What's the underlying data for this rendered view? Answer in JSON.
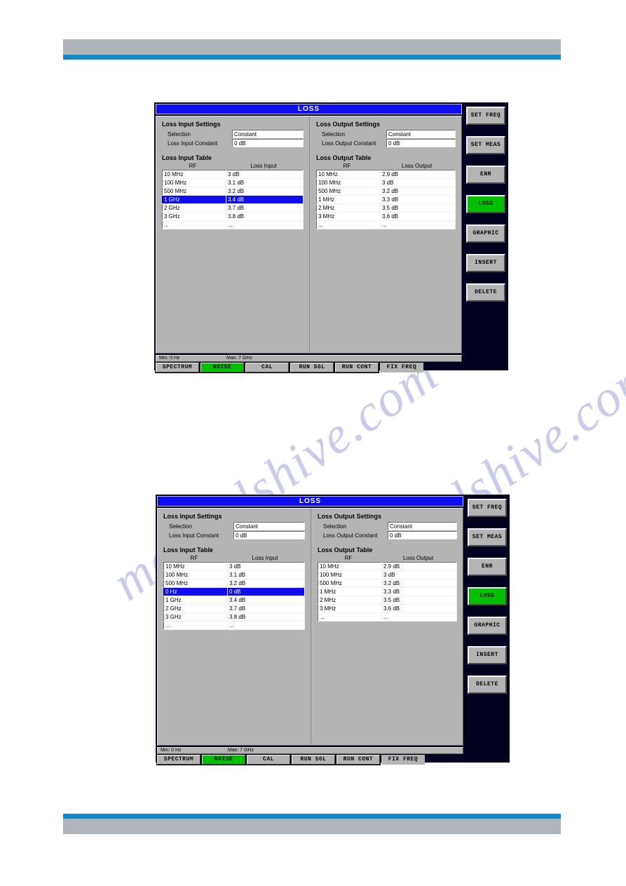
{
  "panels": [
    {
      "window_title": "LOSS",
      "input_settings": {
        "group_title": "Loss Input Settings",
        "rows": [
          {
            "label": "Selection",
            "value": "Constant"
          },
          {
            "label": "Loss Input Constant",
            "value": "0 dB"
          }
        ]
      },
      "output_settings": {
        "group_title": "Loss Output Settings",
        "rows": [
          {
            "label": "Selection",
            "value": "Constant"
          },
          {
            "label": "Loss Output Constant",
            "value": "0 dB"
          }
        ]
      },
      "input_table": {
        "title": "Loss Input Table",
        "headers": [
          "RF",
          "Loss Input"
        ],
        "rows": [
          {
            "rf": "10 MHz",
            "loss": "3 dB",
            "selected": false
          },
          {
            "rf": "100 MHz",
            "loss": "3.1 dB",
            "selected": false
          },
          {
            "rf": "500 MHz",
            "loss": "3.2 dB",
            "selected": false
          },
          {
            "rf": "1 GHz",
            "loss": "3.4 dB",
            "selected": true
          },
          {
            "rf": "2 GHz",
            "loss": "3.7 dB",
            "selected": false
          },
          {
            "rf": "3 GHz",
            "loss": "3.8 dB",
            "selected": false
          },
          {
            "rf": "...",
            "loss": "...",
            "selected": false
          }
        ]
      },
      "output_table": {
        "title": "Loss Output Table",
        "headers": [
          "RF",
          "Loss Output"
        ],
        "rows": [
          {
            "rf": "10 MHz",
            "loss": "2.9 dB",
            "selected": false
          },
          {
            "rf": "100 MHz",
            "loss": "3 dB",
            "selected": false
          },
          {
            "rf": "500 MHz",
            "loss": "3.2 dB",
            "selected": false
          },
          {
            "rf": "1 MHz",
            "loss": "3.3 dB",
            "selected": false
          },
          {
            "rf": "2 MHz",
            "loss": "3.5 dB",
            "selected": false
          },
          {
            "rf": "3 MHz",
            "loss": "3.6 dB",
            "selected": false
          },
          {
            "rf": "...",
            "loss": "...",
            "selected": false
          }
        ]
      },
      "status": {
        "min": "Min: 0 Hz",
        "max": "Max: 7 GHz"
      },
      "toolbar": [
        {
          "label": "SPECTRUM",
          "state": "normal",
          "key": "spectrum"
        },
        {
          "label": "NOISE",
          "state": "active",
          "key": "noise"
        },
        {
          "label": "CAL",
          "state": "normal",
          "key": "cal"
        },
        {
          "label": "RUN SGL",
          "state": "normal",
          "key": "run-sgl"
        },
        {
          "label": "RUN CONT",
          "state": "normal",
          "key": "run-cont"
        },
        {
          "label": "FIX FREQ",
          "state": "flat",
          "key": "fix-freq"
        }
      ],
      "softkeys": [
        {
          "label": "SET FREQ",
          "state": "normal",
          "key": "set-freq"
        },
        {
          "label": "SET MEAS",
          "state": "normal",
          "key": "set-meas"
        },
        {
          "label": "ENR",
          "state": "normal",
          "key": "enr"
        },
        {
          "label": "LOSS",
          "state": "active",
          "key": "loss"
        },
        {
          "label": "GRAPHIC",
          "state": "normal",
          "key": "graphic"
        },
        {
          "label": "INSERT",
          "state": "normal",
          "key": "insert"
        },
        {
          "label": "DELETE",
          "state": "normal",
          "key": "delete"
        }
      ]
    },
    {
      "window_title": "LOSS",
      "input_settings": {
        "group_title": "Loss Input Settings",
        "rows": [
          {
            "label": "Selection",
            "value": "Constant"
          },
          {
            "label": "Loss Input Constant",
            "value": "0 dB"
          }
        ]
      },
      "output_settings": {
        "group_title": "Loss Output Settings",
        "rows": [
          {
            "label": "Selection",
            "value": "Constant"
          },
          {
            "label": "Loss Output Constant",
            "value": "0 dB"
          }
        ]
      },
      "input_table": {
        "title": "Loss Input Table",
        "headers": [
          "RF",
          "Loss Input"
        ],
        "rows": [
          {
            "rf": "10 MHz",
            "loss": "3 dB",
            "selected": false
          },
          {
            "rf": "100 MHz",
            "loss": "3.1 dB",
            "selected": false
          },
          {
            "rf": "500 MHz",
            "loss": "3.2 dB",
            "selected": false
          },
          {
            "rf": "0 Hz",
            "loss": "0 dB",
            "selected": true
          },
          {
            "rf": "1 GHz",
            "loss": "3.4 dB",
            "selected": false
          },
          {
            "rf": "2 GHz",
            "loss": "3.7 dB",
            "selected": false
          },
          {
            "rf": "3 GHz",
            "loss": "3.8 dB",
            "selected": false
          },
          {
            "rf": "...",
            "loss": "...",
            "selected": false
          }
        ]
      },
      "output_table": {
        "title": "Loss Output Table",
        "headers": [
          "RF",
          "Loss Output"
        ],
        "rows": [
          {
            "rf": "10 MHz",
            "loss": "2.9 dB",
            "selected": false
          },
          {
            "rf": "100 MHz",
            "loss": "3 dB",
            "selected": false
          },
          {
            "rf": "500 MHz",
            "loss": "3.2 dB",
            "selected": false
          },
          {
            "rf": "1 MHz",
            "loss": "3.3 dB",
            "selected": false
          },
          {
            "rf": "2 MHz",
            "loss": "3.5 dB",
            "selected": false
          },
          {
            "rf": "3 MHz",
            "loss": "3.6 dB",
            "selected": false
          },
          {
            "rf": "...",
            "loss": "...",
            "selected": false
          }
        ]
      },
      "status": {
        "min": "Min: 0 Hz",
        "max": "Max: 7 GHz"
      },
      "toolbar": [
        {
          "label": "SPECTRUM",
          "state": "normal",
          "key": "spectrum"
        },
        {
          "label": "NOISE",
          "state": "active",
          "key": "noise"
        },
        {
          "label": "CAL",
          "state": "normal",
          "key": "cal"
        },
        {
          "label": "RUN SGL",
          "state": "normal",
          "key": "run-sgl"
        },
        {
          "label": "RUN CONT",
          "state": "normal",
          "key": "run-cont"
        },
        {
          "label": "FIX FREQ",
          "state": "flat",
          "key": "fix-freq"
        }
      ],
      "softkeys": [
        {
          "label": "SET FREQ",
          "state": "normal",
          "key": "set-freq"
        },
        {
          "label": "SET MEAS",
          "state": "normal",
          "key": "set-meas"
        },
        {
          "label": "ENR",
          "state": "normal",
          "key": "enr"
        },
        {
          "label": "LOSS",
          "state": "active",
          "key": "loss"
        },
        {
          "label": "GRAPHIC",
          "state": "normal",
          "key": "graphic"
        },
        {
          "label": "INSERT",
          "state": "normal",
          "key": "insert"
        },
        {
          "label": "DELETE",
          "state": "normal",
          "key": "delete"
        }
      ]
    }
  ],
  "watermark": {
    "text": "manualshive.com"
  },
  "theme": {
    "title_blue": "#0d0df0",
    "select_blue": "#0d0df0",
    "active_green": "#00c000",
    "panel_gray": "#b4b4b4",
    "screen_navy": "#00001f",
    "doc_band_gray": "#b0b5bb",
    "doc_band_blue": "#1288ca"
  }
}
